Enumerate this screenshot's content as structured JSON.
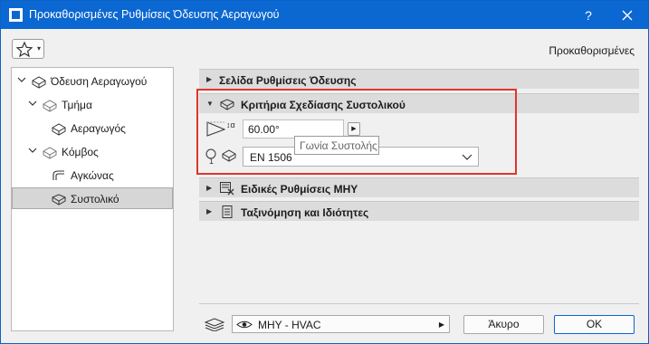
{
  "window": {
    "title": "Προκαθορισμένες Ρυθμίσεις Όδευσης Αεραγωγού",
    "help_label": "?",
    "preset_label": "Προκαθορισμένες"
  },
  "tree": {
    "items": [
      {
        "label": "Όδευση Αεραγωγού",
        "level": 0,
        "expanded": true
      },
      {
        "label": "Τμήμα",
        "level": 1,
        "expanded": true
      },
      {
        "label": "Αεραγωγός",
        "level": 2
      },
      {
        "label": "Κόμβος",
        "level": 1,
        "expanded": true
      },
      {
        "label": "Αγκώνας",
        "level": 2
      },
      {
        "label": "Συστολικό",
        "level": 2,
        "selected": true
      }
    ]
  },
  "sections": {
    "route_settings": "Σελίδα Ρυθμίσεις Όδευσης",
    "reducer_criteria": "Κριτήρια Σχεδίασης Συστολικού",
    "mep_settings": "Ειδικές Ρυθμίσεις ΜΗΥ",
    "classification": "Ταξινόμηση και Ιδιότητες"
  },
  "reducer": {
    "angle_value": "60.00°",
    "angle_tooltip": "Γωνία Συστολής",
    "standard_value": "EN 1506"
  },
  "footer": {
    "layer_value": "ΜΗΥ - HVAC",
    "cancel_label": "Άκυρο",
    "ok_label": "OK"
  },
  "colors": {
    "titlebar": "#0b67d1",
    "highlight": "#e0352b",
    "section_header": "#dcdcdc",
    "selected_row": "#d6d6d6"
  }
}
